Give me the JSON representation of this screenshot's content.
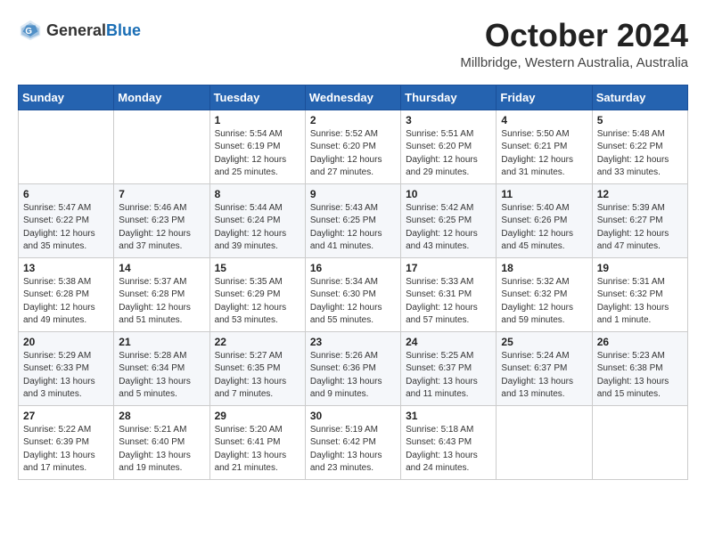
{
  "header": {
    "logo_general": "General",
    "logo_blue": "Blue",
    "month_title": "October 2024",
    "location": "Millbridge, Western Australia, Australia"
  },
  "columns": [
    "Sunday",
    "Monday",
    "Tuesday",
    "Wednesday",
    "Thursday",
    "Friday",
    "Saturday"
  ],
  "weeks": [
    [
      {
        "day": "",
        "data": ""
      },
      {
        "day": "",
        "data": ""
      },
      {
        "day": "1",
        "data": "Sunrise: 5:54 AM\nSunset: 6:19 PM\nDaylight: 12 hours and 25 minutes."
      },
      {
        "day": "2",
        "data": "Sunrise: 5:52 AM\nSunset: 6:20 PM\nDaylight: 12 hours and 27 minutes."
      },
      {
        "day": "3",
        "data": "Sunrise: 5:51 AM\nSunset: 6:20 PM\nDaylight: 12 hours and 29 minutes."
      },
      {
        "day": "4",
        "data": "Sunrise: 5:50 AM\nSunset: 6:21 PM\nDaylight: 12 hours and 31 minutes."
      },
      {
        "day": "5",
        "data": "Sunrise: 5:48 AM\nSunset: 6:22 PM\nDaylight: 12 hours and 33 minutes."
      }
    ],
    [
      {
        "day": "6",
        "data": "Sunrise: 5:47 AM\nSunset: 6:22 PM\nDaylight: 12 hours and 35 minutes."
      },
      {
        "day": "7",
        "data": "Sunrise: 5:46 AM\nSunset: 6:23 PM\nDaylight: 12 hours and 37 minutes."
      },
      {
        "day": "8",
        "data": "Sunrise: 5:44 AM\nSunset: 6:24 PM\nDaylight: 12 hours and 39 minutes."
      },
      {
        "day": "9",
        "data": "Sunrise: 5:43 AM\nSunset: 6:25 PM\nDaylight: 12 hours and 41 minutes."
      },
      {
        "day": "10",
        "data": "Sunrise: 5:42 AM\nSunset: 6:25 PM\nDaylight: 12 hours and 43 minutes."
      },
      {
        "day": "11",
        "data": "Sunrise: 5:40 AM\nSunset: 6:26 PM\nDaylight: 12 hours and 45 minutes."
      },
      {
        "day": "12",
        "data": "Sunrise: 5:39 AM\nSunset: 6:27 PM\nDaylight: 12 hours and 47 minutes."
      }
    ],
    [
      {
        "day": "13",
        "data": "Sunrise: 5:38 AM\nSunset: 6:28 PM\nDaylight: 12 hours and 49 minutes."
      },
      {
        "day": "14",
        "data": "Sunrise: 5:37 AM\nSunset: 6:28 PM\nDaylight: 12 hours and 51 minutes."
      },
      {
        "day": "15",
        "data": "Sunrise: 5:35 AM\nSunset: 6:29 PM\nDaylight: 12 hours and 53 minutes."
      },
      {
        "day": "16",
        "data": "Sunrise: 5:34 AM\nSunset: 6:30 PM\nDaylight: 12 hours and 55 minutes."
      },
      {
        "day": "17",
        "data": "Sunrise: 5:33 AM\nSunset: 6:31 PM\nDaylight: 12 hours and 57 minutes."
      },
      {
        "day": "18",
        "data": "Sunrise: 5:32 AM\nSunset: 6:32 PM\nDaylight: 12 hours and 59 minutes."
      },
      {
        "day": "19",
        "data": "Sunrise: 5:31 AM\nSunset: 6:32 PM\nDaylight: 13 hours and 1 minute."
      }
    ],
    [
      {
        "day": "20",
        "data": "Sunrise: 5:29 AM\nSunset: 6:33 PM\nDaylight: 13 hours and 3 minutes."
      },
      {
        "day": "21",
        "data": "Sunrise: 5:28 AM\nSunset: 6:34 PM\nDaylight: 13 hours and 5 minutes."
      },
      {
        "day": "22",
        "data": "Sunrise: 5:27 AM\nSunset: 6:35 PM\nDaylight: 13 hours and 7 minutes."
      },
      {
        "day": "23",
        "data": "Sunrise: 5:26 AM\nSunset: 6:36 PM\nDaylight: 13 hours and 9 minutes."
      },
      {
        "day": "24",
        "data": "Sunrise: 5:25 AM\nSunset: 6:37 PM\nDaylight: 13 hours and 11 minutes."
      },
      {
        "day": "25",
        "data": "Sunrise: 5:24 AM\nSunset: 6:37 PM\nDaylight: 13 hours and 13 minutes."
      },
      {
        "day": "26",
        "data": "Sunrise: 5:23 AM\nSunset: 6:38 PM\nDaylight: 13 hours and 15 minutes."
      }
    ],
    [
      {
        "day": "27",
        "data": "Sunrise: 5:22 AM\nSunset: 6:39 PM\nDaylight: 13 hours and 17 minutes."
      },
      {
        "day": "28",
        "data": "Sunrise: 5:21 AM\nSunset: 6:40 PM\nDaylight: 13 hours and 19 minutes."
      },
      {
        "day": "29",
        "data": "Sunrise: 5:20 AM\nSunset: 6:41 PM\nDaylight: 13 hours and 21 minutes."
      },
      {
        "day": "30",
        "data": "Sunrise: 5:19 AM\nSunset: 6:42 PM\nDaylight: 13 hours and 23 minutes."
      },
      {
        "day": "31",
        "data": "Sunrise: 5:18 AM\nSunset: 6:43 PM\nDaylight: 13 hours and 24 minutes."
      },
      {
        "day": "",
        "data": ""
      },
      {
        "day": "",
        "data": ""
      }
    ]
  ]
}
